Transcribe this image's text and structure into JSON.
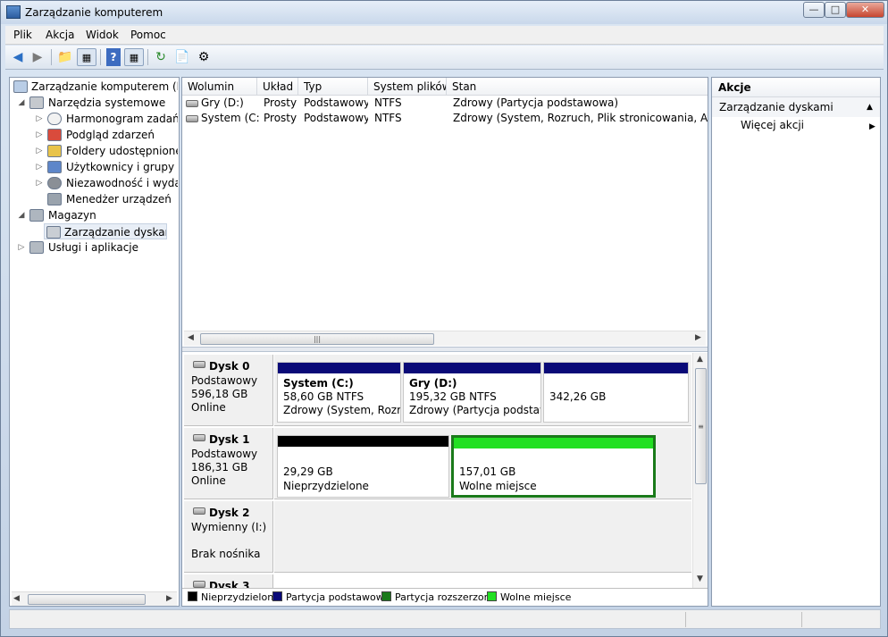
{
  "window": {
    "title": "Zarządzanie komputerem"
  },
  "menu": [
    "Plik",
    "Akcja",
    "Widok",
    "Pomoc"
  ],
  "toolbar": {
    "icons": [
      "back-icon",
      "forward-icon",
      "up-folder-icon",
      "show-tree-icon",
      "help-icon",
      "view-icon",
      "refresh-icon",
      "properties-icon",
      "settings-icon"
    ]
  },
  "tree": {
    "items": [
      {
        "label": "Zarządzanie komputerem (loka",
        "icon": "computer-icon"
      },
      {
        "label": "Narzędzia systemowe",
        "icon": "tools-icon"
      },
      {
        "label": "Harmonogram zadań",
        "icon": "clock-icon"
      },
      {
        "label": "Podgląd zdarzeń",
        "icon": "event-viewer-icon"
      },
      {
        "label": "Foldery udostępnione",
        "icon": "shared-folder-icon"
      },
      {
        "label": "Użytkownicy i grupy lok",
        "icon": "users-icon"
      },
      {
        "label": "Niezawodność i wydajn",
        "icon": "performance-icon"
      },
      {
        "label": "Menedżer urządzeń",
        "icon": "device-manager-icon"
      },
      {
        "label": "Magazyn",
        "icon": "storage-icon"
      },
      {
        "label": "Zarządzanie dyskami",
        "icon": "disk-management-icon"
      },
      {
        "label": "Usługi i aplikacje",
        "icon": "services-icon"
      }
    ]
  },
  "volumes": {
    "columns": [
      "Wolumin",
      "Układ",
      "Typ",
      "System plików",
      "Stan"
    ],
    "rows": [
      {
        "name": "Gry (D:)",
        "layout": "Prosty",
        "type": "Podstawowy",
        "fs": "NTFS",
        "status": "Zdrowy (Partycja podstawowa)"
      },
      {
        "name": "System (C:)",
        "layout": "Prosty",
        "type": "Podstawowy",
        "fs": "NTFS",
        "status": "Zdrowy (System, Rozruch, Plik stronicowania, Aktywna"
      }
    ]
  },
  "disks": [
    {
      "name": "Dysk 0",
      "type": "Podstawowy",
      "size": "596,18 GB",
      "state": "Online",
      "partitions": [
        {
          "title": "System  (C:)",
          "size": "58,60 GB NTFS",
          "status": "Zdrowy (System, Rozruc"
        },
        {
          "title": "Gry  (D:)",
          "size": "195,32 GB NTFS",
          "status": "Zdrowy (Partycja podstawo"
        },
        {
          "title": "",
          "size": "342,26 GB",
          "status": ""
        }
      ]
    },
    {
      "name": "Dysk 1",
      "type": "Podstawowy",
      "size": "186,31 GB",
      "state": "Online",
      "partitions": [
        {
          "size": "29,29 GB",
          "status": "Nieprzydzielone"
        },
        {
          "size": "157,01 GB",
          "status": "Wolne miejsce"
        }
      ]
    },
    {
      "name": "Dysk 2",
      "type": "Wymienny (I:)",
      "size": "",
      "state": "Brak nośnika",
      "partitions": []
    },
    {
      "name": "Dysk 3"
    }
  ],
  "legend": [
    {
      "label": "Nieprzydzielone",
      "color": "#000000"
    },
    {
      "label": "Partycja podstawowa",
      "color": "#0a0a78"
    },
    {
      "label": "Partycja rozszerzona",
      "color": "#1a7a1a"
    },
    {
      "label": "Wolne miejsce",
      "color": "#22e022"
    }
  ],
  "actions": {
    "header": "Akcje",
    "section": "Zarządzanie dyskami",
    "items": [
      "Więcej akcji"
    ]
  },
  "colors": {
    "primary_partition": "#0a0a78",
    "unallocated": "#000000",
    "extended": "#1a7a1a",
    "free_space": "#22e022"
  }
}
